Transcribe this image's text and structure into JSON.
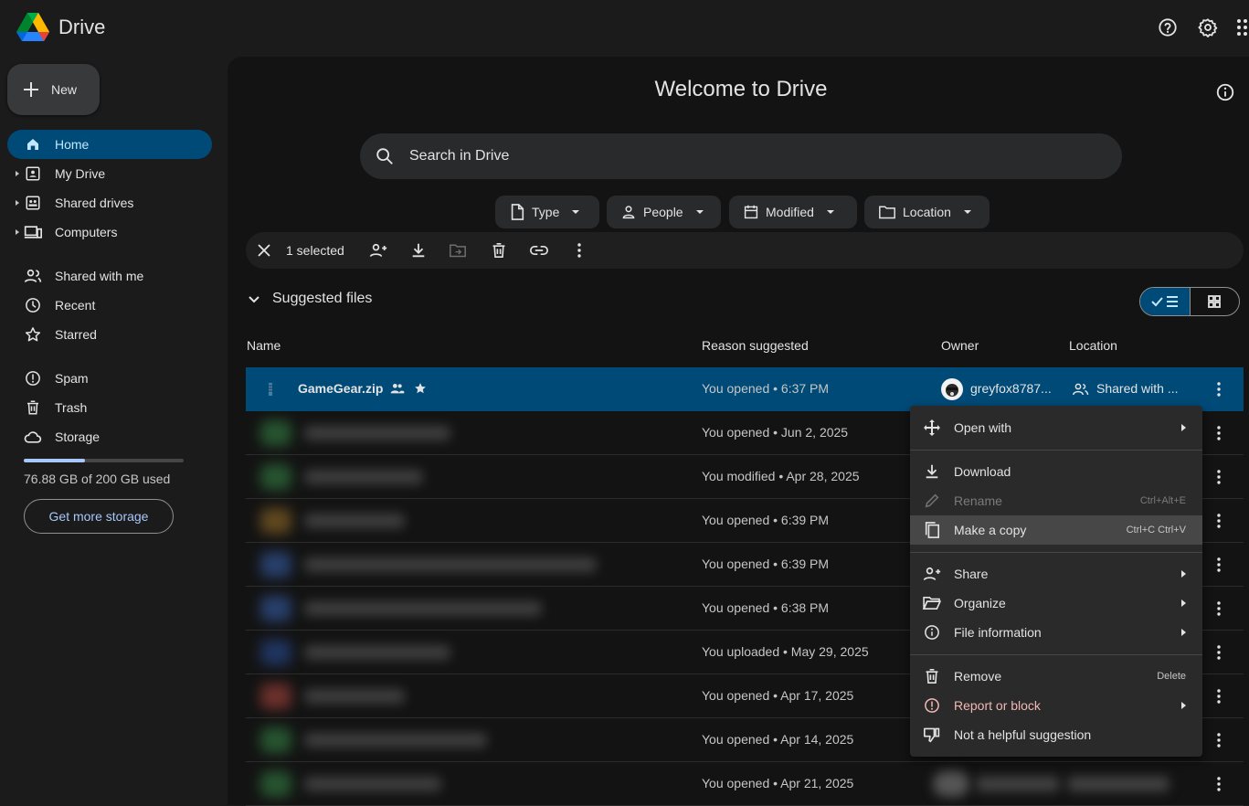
{
  "app": {
    "title": "Drive"
  },
  "header": {
    "help_icon": "help-icon",
    "settings_icon": "gear-icon",
    "apps_icon": "apps-grid-icon"
  },
  "sidebar": {
    "new_label": "New",
    "items": [
      {
        "label": "Home",
        "icon": "home-icon"
      },
      {
        "label": "My Drive",
        "icon": "my-drive-icon"
      },
      {
        "label": "Shared drives",
        "icon": "shared-drives-icon"
      },
      {
        "label": "Computers",
        "icon": "computers-icon"
      },
      {
        "label": "Shared with me",
        "icon": "people-icon"
      },
      {
        "label": "Recent",
        "icon": "clock-icon"
      },
      {
        "label": "Starred",
        "icon": "star-icon"
      },
      {
        "label": "Spam",
        "icon": "spam-icon"
      },
      {
        "label": "Trash",
        "icon": "trash-icon"
      },
      {
        "label": "Storage",
        "icon": "cloud-icon"
      }
    ],
    "storage": {
      "used_fraction": 0.3844,
      "text": "76.88 GB of 200 GB used",
      "button": "Get more storage"
    }
  },
  "main": {
    "title": "Welcome to Drive",
    "search": {
      "placeholder": "Search in Drive"
    },
    "filters": [
      {
        "label": "Type",
        "icon": "file-icon"
      },
      {
        "label": "People",
        "icon": "person-icon"
      },
      {
        "label": "Modified",
        "icon": "calendar-icon"
      },
      {
        "label": "Location",
        "icon": "folder-icon"
      }
    ],
    "selection_bar": {
      "count_label": "1 selected"
    },
    "section": {
      "title": "Suggested files"
    },
    "columns": {
      "name": "Name",
      "reason": "Reason suggested",
      "owner": "Owner",
      "location": "Location"
    },
    "selected_file": {
      "name": "GameGear.zip",
      "reason": "You opened • 6:37 PM",
      "owner": "greyfox8787...",
      "location": "Shared with ...",
      "shared": true,
      "starred": true
    },
    "rows": [
      {
        "reason": "You opened • Jun 2, 2025"
      },
      {
        "reason": "You modified • Apr 28, 2025"
      },
      {
        "reason": "You opened • 6:39 PM"
      },
      {
        "reason": "You opened • 6:39 PM"
      },
      {
        "reason": "You opened • 6:38 PM"
      },
      {
        "reason": "You uploaded • May 29, 2025"
      },
      {
        "reason": "You opened • Apr 17, 2025"
      },
      {
        "reason": "You opened • Apr 14, 2025"
      },
      {
        "reason": "You opened • Apr 21, 2025"
      }
    ]
  },
  "context_menu": {
    "open_with": "Open with",
    "download": "Download",
    "rename": "Rename",
    "rename_shortcut": "Ctrl+Alt+E",
    "make_copy": "Make a copy",
    "make_copy_shortcut": "Ctrl+C Ctrl+V",
    "share": "Share",
    "organize": "Organize",
    "file_information": "File information",
    "remove": "Remove",
    "remove_shortcut": "Delete",
    "report": "Report or block",
    "not_helpful": "Not a helpful suggestion"
  },
  "colors": {
    "accent": "#004a77",
    "accent_text": "#c2e7ff",
    "link": "#a8c7fa",
    "danger": "#f2b8b5",
    "background": "#1b1b1b"
  }
}
